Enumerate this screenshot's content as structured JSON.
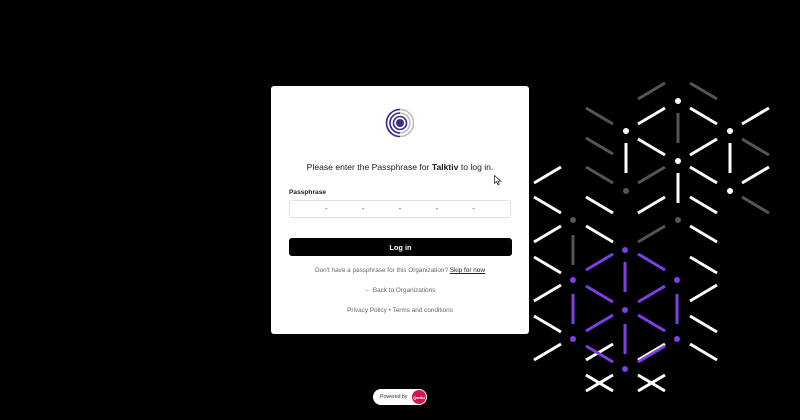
{
  "prompt": {
    "before": "Please enter the Passphrase for ",
    "org": "Talktiv",
    "after": " to log in."
  },
  "passphrase": {
    "label": "Passphrase",
    "slots": [
      "-",
      "-",
      "-",
      "-",
      "-"
    ]
  },
  "login_button": "Log in",
  "skip": {
    "text": "Don't have a passphrase for this Organization? ",
    "link": "Skip for now"
  },
  "back_link": "← Back to Organizations",
  "footer": {
    "privacy": "Privacy Policy",
    "separator": " • ",
    "terms": "Terms and conditions"
  },
  "powered_by": {
    "label": "Powered by",
    "brand": "Qentu"
  },
  "icons": {
    "logo": "concentric-circles-logo",
    "cursor": "mouse-pointer-icon"
  },
  "colors": {
    "background": "#000000",
    "card": "#ffffff",
    "button": "#000000",
    "brand_purple": "#3b2a8c",
    "pattern_purple": "#7b3fe4",
    "badge": "#d4145a"
  }
}
